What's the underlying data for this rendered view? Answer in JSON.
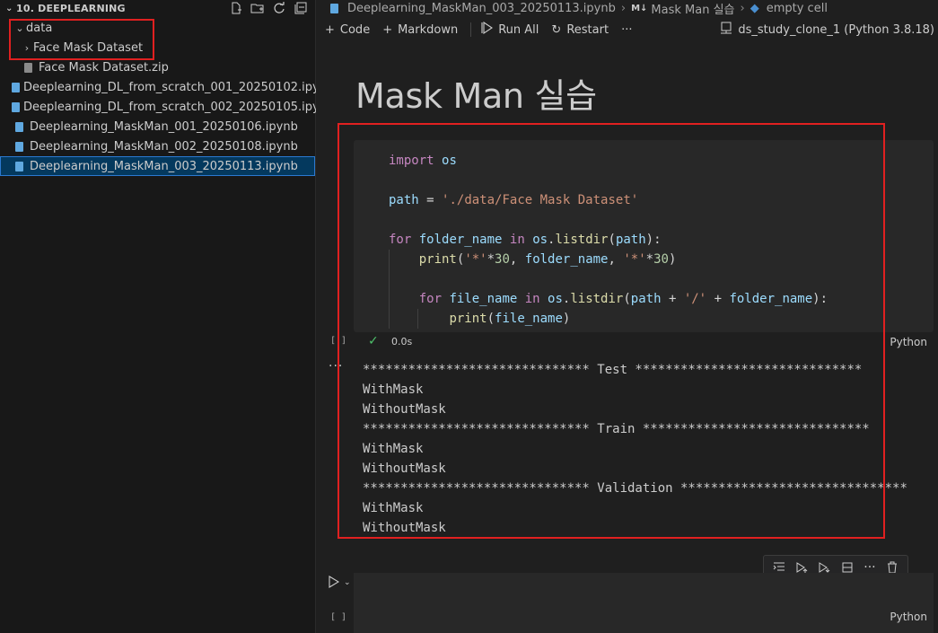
{
  "sidebar": {
    "title": "10. DEEPLEARNING",
    "actions": [
      "new-file-icon",
      "new-folder-icon",
      "refresh-icon",
      "collapse-all-icon"
    ],
    "items": [
      {
        "label": "data",
        "type": "folder",
        "expanded": true
      },
      {
        "label": "Face Mask Dataset",
        "type": "folder",
        "expanded": false
      },
      {
        "label": "Face Mask Dataset.zip",
        "type": "file"
      },
      {
        "label": "Deeplearning_DL_from_scratch_001_20250102.ipynb",
        "type": "notebook"
      },
      {
        "label": "Deeplearning_DL_from_scratch_002_20250105.ipynb",
        "type": "notebook"
      },
      {
        "label": "Deeplearning_MaskMan_001_20250106.ipynb",
        "type": "notebook"
      },
      {
        "label": "Deeplearning_MaskMan_002_20250108.ipynb",
        "type": "notebook"
      },
      {
        "label": "Deeplearning_MaskMan_003_20250113.ipynb",
        "type": "notebook",
        "selected": true
      }
    ]
  },
  "breadcrumb": {
    "file": "Deeplearning_MaskMan_003_20250113.ipynb",
    "md_tag": "M↓",
    "section": "Mask Man 실습",
    "cell": "empty cell"
  },
  "toolbar": {
    "code": "Code",
    "markdown": "Markdown",
    "run_all": "Run All",
    "restart": "Restart",
    "more": "···",
    "kernel": "ds_study_clone_1 (Python 3.8.18)"
  },
  "notebook": {
    "heading": "Mask Man 실습",
    "cell1": {
      "exec_count": "[ ]",
      "duration": "0.0s",
      "language": "Python",
      "output_lines": [
        "****************************** Test ******************************",
        "WithMask",
        "WithoutMask",
        "****************************** Train ******************************",
        "WithMask",
        "WithoutMask",
        "****************************** Validation ******************************",
        "WithMask",
        "WithoutMask"
      ]
    },
    "cell2": {
      "exec_count": "[ ]",
      "language": "Python"
    },
    "output_more": "···"
  },
  "colors": {
    "accent_red": "#e02020",
    "selection": "#04395e",
    "success": "#4ec06b"
  }
}
